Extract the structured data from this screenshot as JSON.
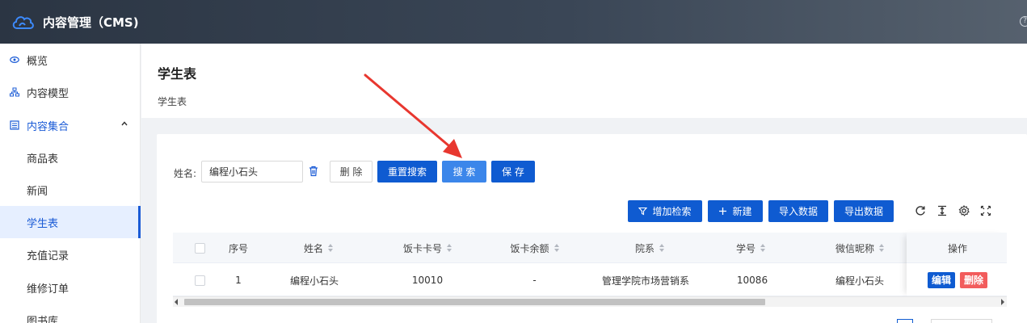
{
  "header": {
    "title": "内容管理（CMS)",
    "help": "?"
  },
  "sidebar": {
    "items": [
      {
        "label": "概览",
        "icon": "eye-icon"
      },
      {
        "label": "内容模型",
        "icon": "sitemap-icon"
      },
      {
        "label": "内容集合",
        "icon": "list-icon"
      },
      {
        "label": "商品表"
      },
      {
        "label": "新闻"
      },
      {
        "label": "学生表"
      },
      {
        "label": "充值记录"
      },
      {
        "label": "维修订单"
      },
      {
        "label": "图书库"
      }
    ]
  },
  "page": {
    "title": "学生表",
    "subtitle": "学生表"
  },
  "search": {
    "name_label": "姓名:",
    "name_value": "编程小石头",
    "delete_label": "删 除",
    "reset_label": "重置搜索",
    "search_label": "搜 索",
    "save_label": "保 存"
  },
  "toolbar": {
    "add_filter_label": "增加检索",
    "new_label": "新建",
    "import_label": "导入数据",
    "export_label": "导出数据"
  },
  "table": {
    "columns": [
      "序号",
      "姓名",
      "饭卡卡号",
      "饭卡余额",
      "院系",
      "学号",
      "微信昵称",
      "操作"
    ],
    "rows": [
      {
        "index": "1",
        "name": "编程小石头",
        "card_no": "10010",
        "balance": "-",
        "dept": "管理学院市场营销系",
        "student_no": "10086",
        "wechat": "编程小石头"
      }
    ],
    "edit_label": "编辑",
    "delete_label": "删除"
  },
  "colors": {
    "primary": "#0f5bd1",
    "danger": "#f25c5c",
    "annotation": "#e8372f"
  }
}
